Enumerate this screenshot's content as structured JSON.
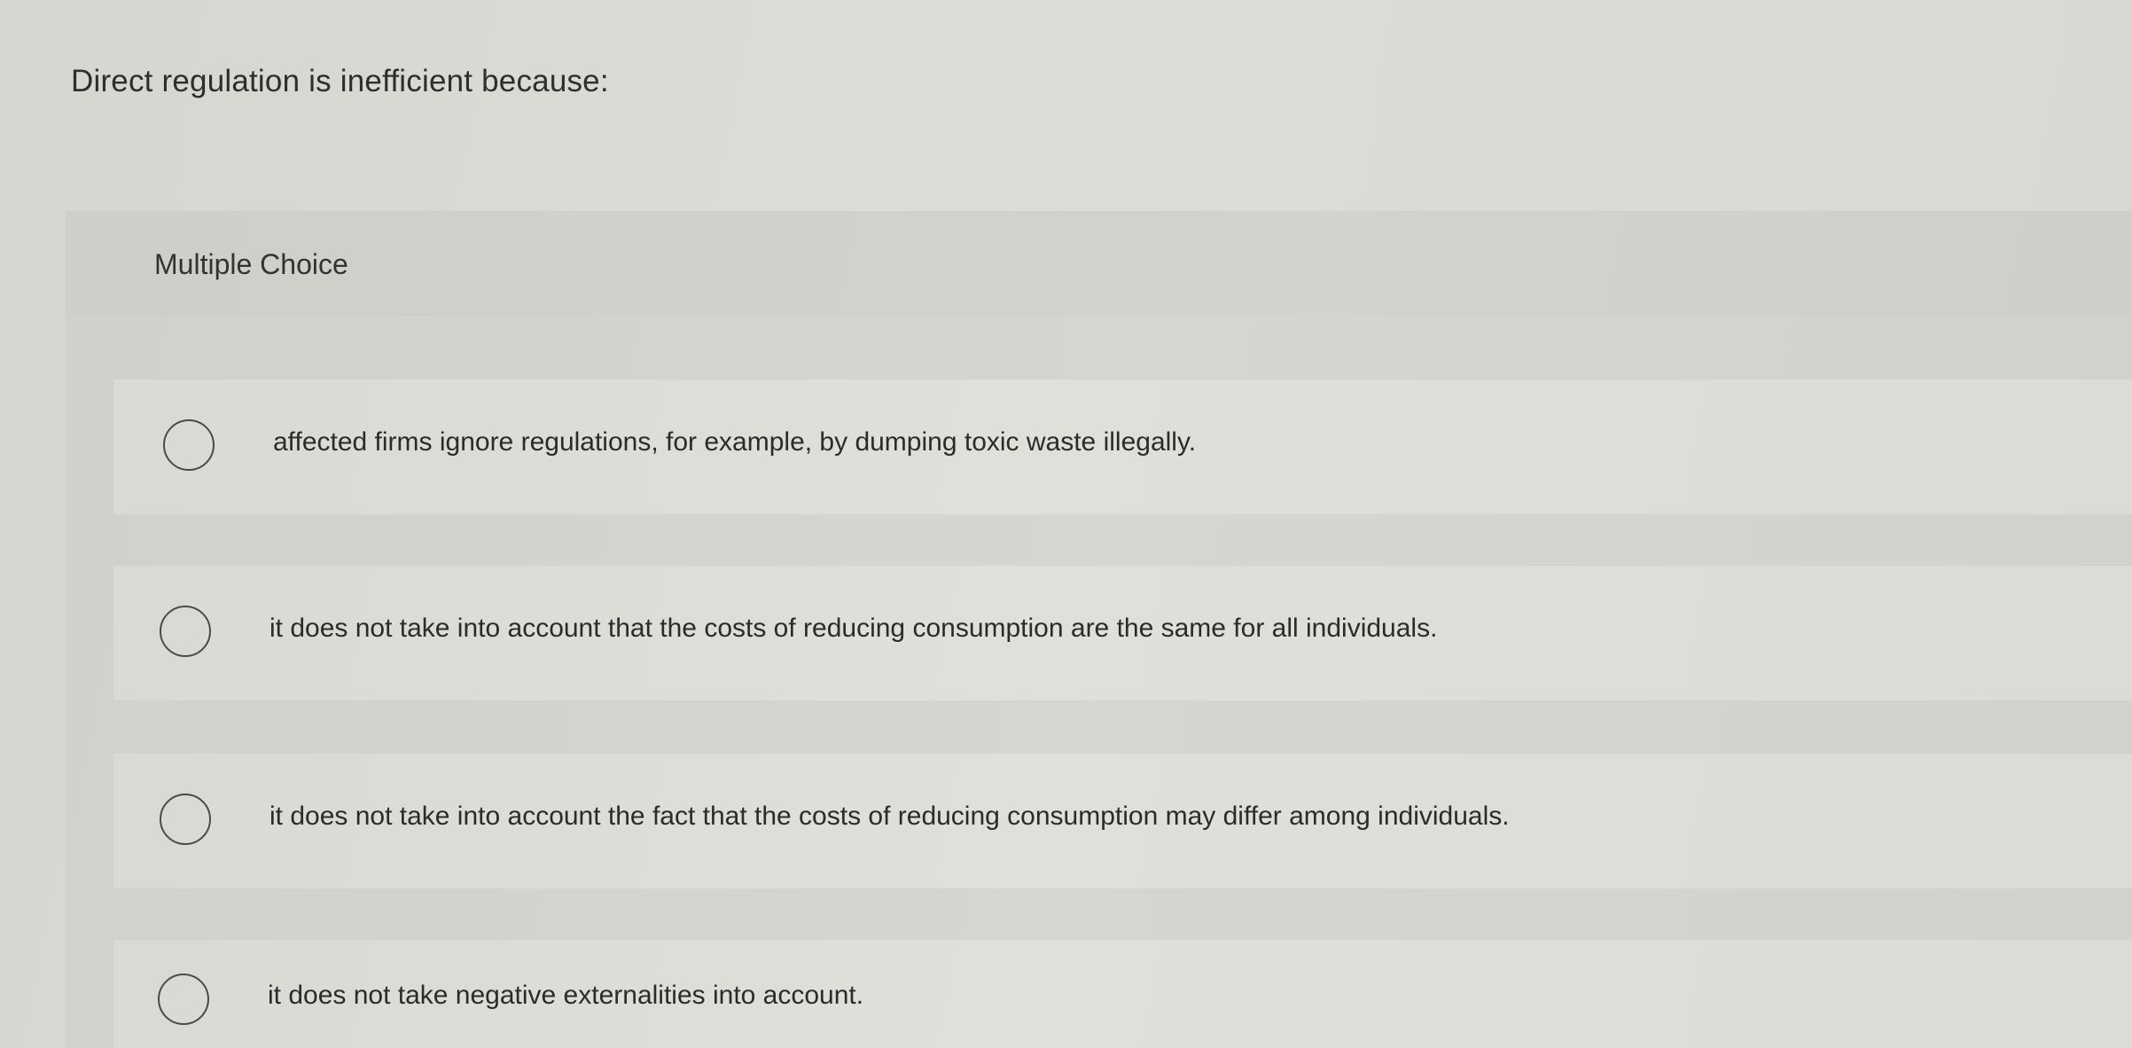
{
  "question": {
    "text": "Direct regulation is inefficient because:"
  },
  "multiple_choice": {
    "label": "Multiple Choice",
    "options": [
      {
        "text": "affected firms ignore regulations, for example, by dumping toxic waste illegally."
      },
      {
        "text": "it does not take into account that the costs of reducing consumption are the same for all individuals."
      },
      {
        "text": "it does not take into account the fact that the costs of reducing consumption may differ among individuals."
      },
      {
        "text": "it does not take negative externalities into account."
      }
    ]
  },
  "colors": {
    "background": "#d9d8d2",
    "panel": "#d3d2cd",
    "option_row": "#dfded9",
    "radio_border": "#4a4a4a",
    "text": "#2e2e2e"
  },
  "icons": {
    "radio": "radio-button-empty"
  }
}
